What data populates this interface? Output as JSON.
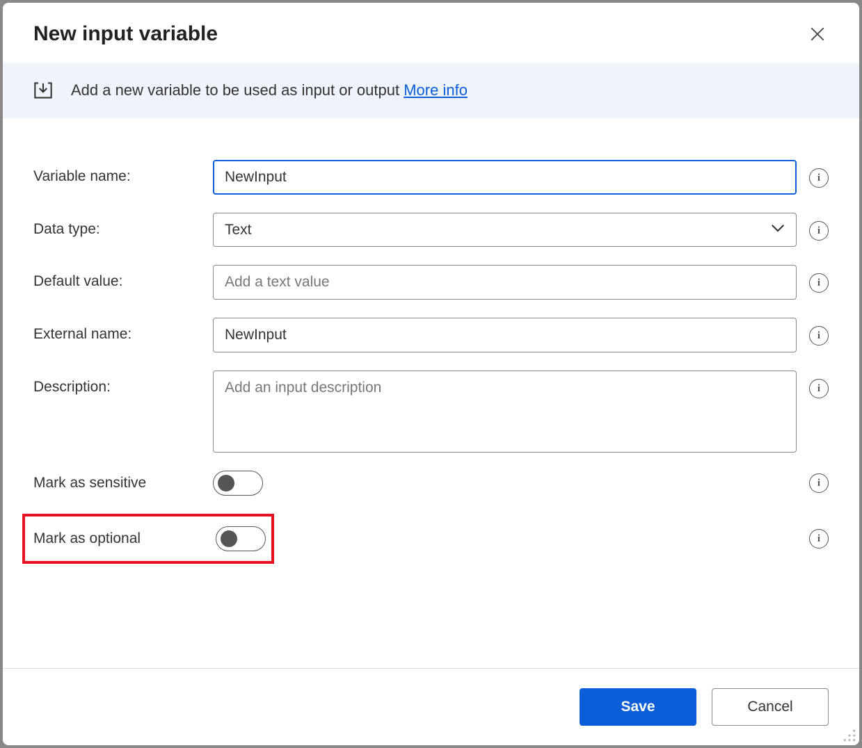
{
  "dialog": {
    "title": "New input variable"
  },
  "banner": {
    "text": "Add a new variable to be used as input or output ",
    "link": "More info"
  },
  "fields": {
    "variable_name": {
      "label": "Variable name:",
      "value": "NewInput"
    },
    "data_type": {
      "label": "Data type:",
      "value": "Text"
    },
    "default_value": {
      "label": "Default value:",
      "value": "",
      "placeholder": "Add a text value"
    },
    "external_name": {
      "label": "External name:",
      "value": "NewInput"
    },
    "description": {
      "label": "Description:",
      "value": "",
      "placeholder": "Add an input description"
    },
    "sensitive": {
      "label": "Mark as sensitive",
      "on": false
    },
    "optional": {
      "label": "Mark as optional",
      "on": false
    }
  },
  "footer": {
    "save": "Save",
    "cancel": "Cancel"
  }
}
